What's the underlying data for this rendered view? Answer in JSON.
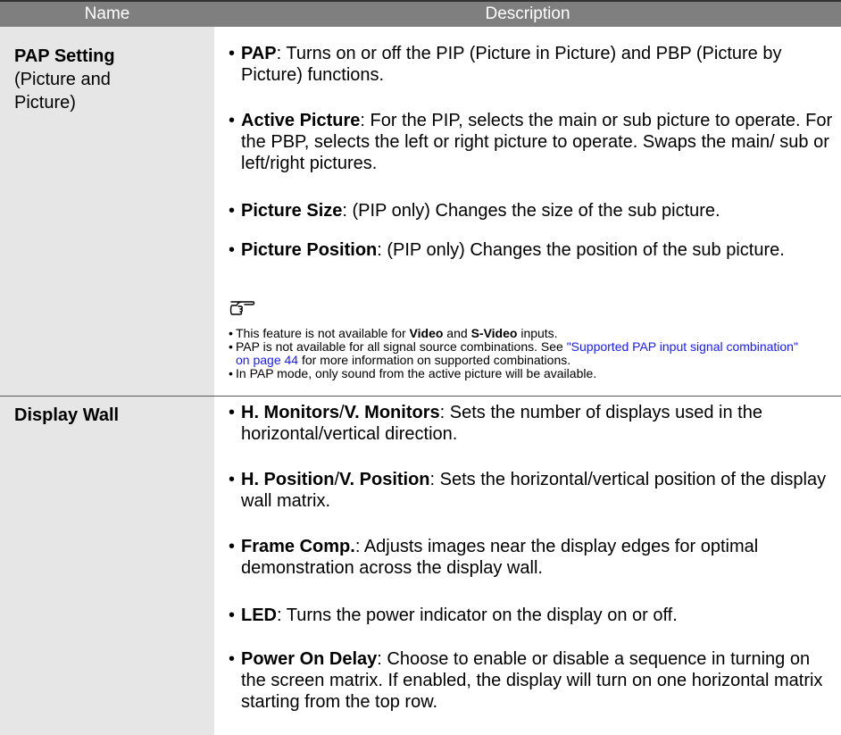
{
  "header": {
    "name": "Name",
    "description": "Description"
  },
  "rows": [
    {
      "name_bold": "PAP Setting",
      "name_sub": "(Picture and Picture)",
      "items": [
        {
          "term": "PAP",
          "text": ": Turns on or off the PIP (Picture in Picture) and PBP (Picture by Picture) functions."
        },
        {
          "term": "Active Picture",
          "text": ": For the PIP, selects the main or sub picture to operate. For the PBP, selects the left or right picture to operate. Swaps the main/ sub or left/right pictures."
        },
        {
          "term": "Picture Size",
          "text": ": (PIP only) Changes the size of the sub picture."
        },
        {
          "term": "Picture Position",
          "text": ": (PIP only) Changes the position of the sub picture."
        }
      ],
      "note_icon": "pointing-hand-icon",
      "notes": {
        "n1_pre": "This feature is not available for ",
        "n1_b1": "Video",
        "n1_mid": " and ",
        "n1_b2": "S-Video",
        "n1_post": " inputs.",
        "n2_pre": "PAP is not available for all signal source combinations. See ",
        "n2_link": "\"Supported PAP input signal combination\" on page 44",
        "n2_post": " for more information on supported combinations.",
        "n3": "In PAP mode, only sound from the active picture will be available."
      }
    },
    {
      "name_bold": "Display Wall",
      "items": [
        {
          "term": "H. Monitors",
          "sep": "/",
          "term2": "V. Monitors",
          "text": ": Sets the number of displays used in the horizontal/vertical direction."
        },
        {
          "term": "H. Position",
          "sep": "/",
          "term2": "V. Position",
          "text": ": Sets the horizontal/vertical position of the display wall matrix."
        },
        {
          "term": "Frame Comp.",
          "text": ": Adjusts images near the display edges for optimal demonstration across the display wall."
        },
        {
          "term": "LED",
          "text": ": Turns the power indicator on the display on or off."
        },
        {
          "term": "Power On Delay",
          "text": ": Choose to enable or disable a sequence in turning on the screen matrix. If enabled, the display will turn on one horizontal matrix starting from the top row."
        }
      ]
    }
  ],
  "bullet": "•"
}
